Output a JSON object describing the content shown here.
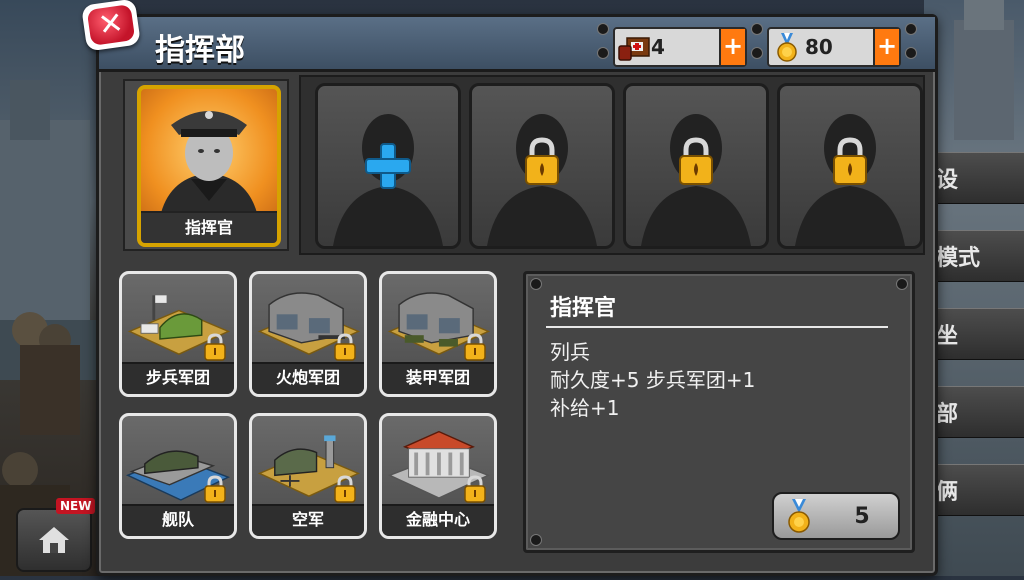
{
  "header": {
    "title": "指挥部",
    "close_icon": "close-icon"
  },
  "resources": {
    "supply": {
      "value": "4",
      "icon": "supply-crate-icon"
    },
    "medal": {
      "value": "80",
      "icon": "medal-icon"
    }
  },
  "commander": {
    "label": "指挥官"
  },
  "slots": [
    {
      "state": "add",
      "icon": "plus-icon"
    },
    {
      "state": "locked",
      "icon": "lock-icon"
    },
    {
      "state": "locked",
      "icon": "lock-icon"
    },
    {
      "state": "locked",
      "icon": "lock-icon"
    }
  ],
  "units": [
    {
      "label": "步兵军团",
      "icon": "infantry-barracks-icon"
    },
    {
      "label": "火炮军团",
      "icon": "artillery-hangar-icon"
    },
    {
      "label": "装甲军团",
      "icon": "armor-hangar-icon"
    },
    {
      "label": "舰队",
      "icon": "naval-base-icon"
    },
    {
      "label": "空军",
      "icon": "airfield-icon"
    },
    {
      "label": "金融中心",
      "icon": "finance-center-icon"
    }
  ],
  "info": {
    "title": "指挥官",
    "rank": "列兵",
    "bonus_line": "耐久度+5  步兵军团+1",
    "supply_line": "补给+1",
    "cost": "5"
  },
  "side_tabs": [
    "设",
    "模式",
    "坐",
    "部",
    "俩"
  ],
  "home": {
    "badge": "NEW"
  },
  "colors": {
    "title_bar": "#4b5f76",
    "accent_orange": "#ff7a10",
    "close_red": "#d51f35",
    "frame_gold": "#d6a300"
  }
}
